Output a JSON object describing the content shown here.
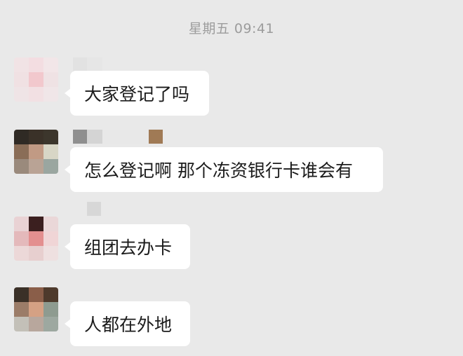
{
  "chat": {
    "timestamp": "星期五 09:41",
    "messages": [
      {
        "text": "大家登记了吗",
        "avatar_colors": [
          "#f1e3e5",
          "#f3dde1",
          "#f2e6e8",
          "#f0e1e3",
          "#f2c8cd",
          "#efe2e4",
          "#efe4e6",
          "#f2e0e3",
          "#f0e6e8"
        ],
        "name_colors": [
          "#e2e2e2",
          "#e6e6e6"
        ]
      },
      {
        "text": "怎么登记啊 那个冻资银行卡谁会有",
        "avatar_colors": [
          "#2f2a24",
          "#3a3128",
          "#3c362c",
          "#8a6d57",
          "#c19a84",
          "#d8d6c6",
          "#9a8a7c",
          "#b9a395",
          "#9aa6a0"
        ],
        "name_colors": [
          "#8f8f8f",
          "#d4d4d4",
          "#e8e8e8",
          "#e8e8e8",
          "#e8e8e8",
          "#a07a55"
        ]
      },
      {
        "text": "组团去办卡",
        "avatar_colors": [
          "#e9d2d4",
          "#3b1f1f",
          "#ead7d8",
          "#e4b9bb",
          "#e38f8f",
          "#f0d5d6",
          "#ecd8d8",
          "#e7cfcf",
          "#eee0e0"
        ],
        "name_colors": [
          "#d7d7d7"
        ]
      },
      {
        "text": "人都在外地",
        "avatar_colors": [
          "#3a3027",
          "#8a5e49",
          "#4e3a2c",
          "#9b7c68",
          "#d5a184",
          "#8e9b90",
          "#c3c0b8",
          "#b8a79d",
          "#9da8a0"
        ],
        "name_colors": []
      }
    ]
  }
}
